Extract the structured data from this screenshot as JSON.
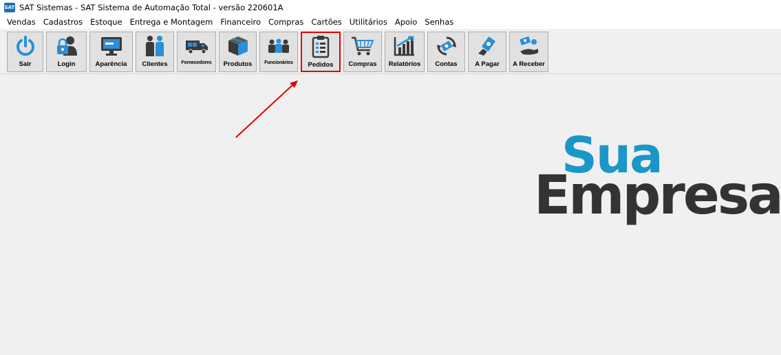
{
  "window": {
    "title": "SAT Sistemas - SAT Sistema de Automação Total - versão 220601A",
    "icon": "sat-app-icon",
    "icon_text": "SAT"
  },
  "menu": [
    "Vendas",
    "Cadastros",
    "Estoque",
    "Entrega e Montagem",
    "Financeiro",
    "Compras",
    "Cartões",
    "Utilitários",
    "Apoio",
    "Senhas"
  ],
  "toolbar": {
    "buttons": [
      {
        "label": "Sair",
        "icon": "power-icon"
      },
      {
        "label": "Login",
        "icon": "user-lock-icon"
      },
      {
        "label": "Aparência",
        "icon": "monitor-icon"
      },
      {
        "label": "Clientes",
        "icon": "people-icon"
      },
      {
        "label": "Fornecedores",
        "icon": "truck-icon"
      },
      {
        "label": "Produtos",
        "icon": "boxes-icon"
      },
      {
        "label": "Funcionários",
        "icon": "team-icon"
      },
      {
        "label": "Pedidos",
        "icon": "clipboard-list-icon",
        "selected": true
      },
      {
        "label": "Compras",
        "icon": "shopping-cart-icon"
      },
      {
        "label": "Relatórios",
        "icon": "bar-chart-icon"
      },
      {
        "label": "Contas",
        "icon": "money-cycle-icon"
      },
      {
        "label": "A Pagar",
        "icon": "pay-money-icon"
      },
      {
        "label": "A Receber",
        "icon": "receive-money-icon"
      }
    ]
  },
  "logo": {
    "line1": "Sua",
    "line2": "Empresa"
  },
  "colors": {
    "highlight": "#e00000",
    "arrow": "#e00000",
    "logo_blue": "#1b96c8",
    "logo_dark": "#333333",
    "icon_blue": "#2a8fd6"
  }
}
